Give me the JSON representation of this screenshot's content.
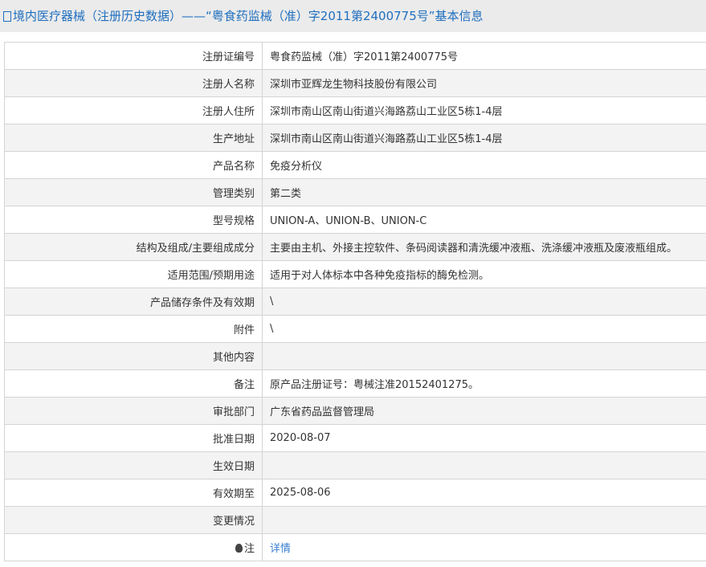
{
  "title": "境内医疗器械（注册历史数据）——“粤食药监械（准）字2011第2400775号”基本信息",
  "rows": [
    {
      "k": "注册证编号",
      "v": "粤食药监械（准）字2011第2400775号"
    },
    {
      "k": "注册人名称",
      "v": "深圳市亚辉龙生物科技股份有限公司"
    },
    {
      "k": "注册人住所",
      "v": "深圳市南山区南山街道兴海路荔山工业区5栋1-4层"
    },
    {
      "k": "生产地址",
      "v": "深圳市南山区南山街道兴海路荔山工业区5栋1-4层"
    },
    {
      "k": "产品名称",
      "v": "免疫分析仪"
    },
    {
      "k": "管理类别",
      "v": "第二类"
    },
    {
      "k": "型号规格",
      "v": "UNION-A、UNION-B、UNION-C"
    },
    {
      "k": "结构及组成/主要组成成分",
      "v": "主要由主机、外接主控软件、条码阅读器和清洗缓冲液瓶、洗涤缓冲液瓶及废液瓶组成。"
    },
    {
      "k": "适用范围/预期用途",
      "v": "适用于对人体标本中各种免疫指标的酶免检测。"
    },
    {
      "k": "产品储存条件及有效期",
      "v": "\\"
    },
    {
      "k": "附件",
      "v": "\\"
    },
    {
      "k": "其他内容",
      "v": ""
    },
    {
      "k": "备注",
      "v": "原产品注册证号：粤械注准20152401275。"
    },
    {
      "k": "审批部门",
      "v": "广东省药品监督管理局"
    },
    {
      "k": "批准日期",
      "v": "2020-08-07"
    },
    {
      "k": "生效日期",
      "v": ""
    },
    {
      "k": "有效期至",
      "v": "2025-08-06"
    },
    {
      "k": "变更情况",
      "v": ""
    }
  ],
  "note": {
    "k": "注",
    "link": "详情"
  }
}
